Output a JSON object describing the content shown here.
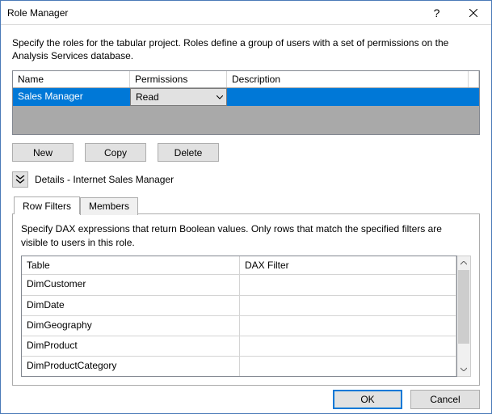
{
  "window": {
    "title": "Role Manager"
  },
  "instructions": "Specify the roles for the tabular project. Roles define a group of users with a set of permissions on the Analysis Services database.",
  "roles_grid": {
    "headers": {
      "name": "Name",
      "permissions": "Permissions",
      "description": "Description"
    },
    "rows": [
      {
        "name": "Sales Manager",
        "permissions": "Read",
        "description": ""
      }
    ]
  },
  "buttons": {
    "new": "New",
    "copy": "Copy",
    "delete": "Delete"
  },
  "details": {
    "label": "Details - Internet Sales Manager"
  },
  "tabs": {
    "row_filters": "Row Filters",
    "members": "Members",
    "active": "row_filters"
  },
  "row_filters": {
    "instructions": "Specify DAX expressions that return Boolean values. Only rows that match the specified filters are visible to users in this role.",
    "headers": {
      "table": "Table",
      "dax": "DAX Filter"
    },
    "rows": [
      {
        "table": "DimCustomer",
        "dax": ""
      },
      {
        "table": "DimDate",
        "dax": ""
      },
      {
        "table": "DimGeography",
        "dax": ""
      },
      {
        "table": "DimProduct",
        "dax": ""
      },
      {
        "table": "DimProductCategory",
        "dax": ""
      }
    ]
  },
  "footer": {
    "ok": "OK",
    "cancel": "Cancel"
  }
}
